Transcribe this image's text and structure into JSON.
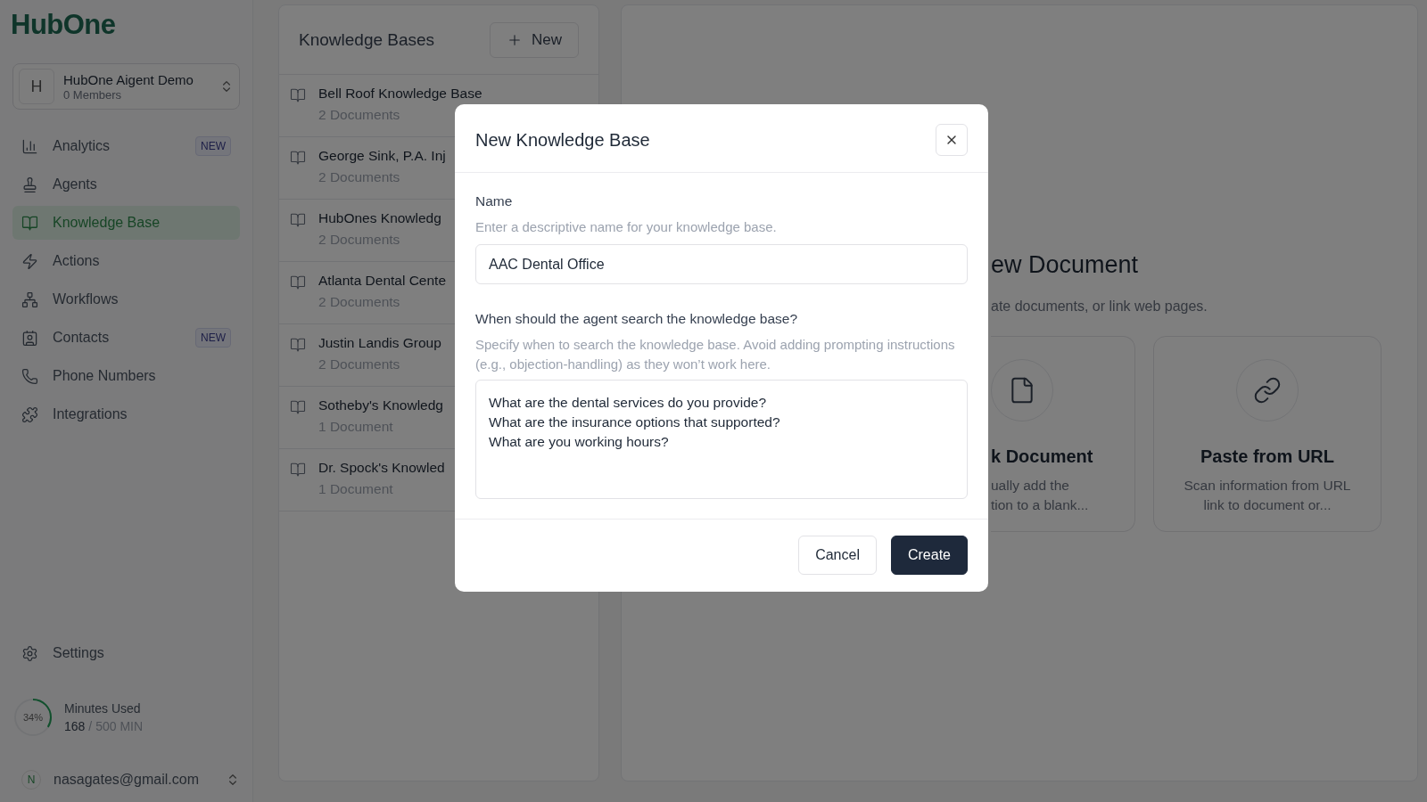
{
  "logo": {
    "text": "HubOne"
  },
  "workspace": {
    "initial": "H",
    "name": "HubOne Aigent Demo",
    "members": "0 Members"
  },
  "nav": [
    {
      "label": "Analytics",
      "badge": "NEW",
      "selected": false
    },
    {
      "label": "Agents",
      "selected": false
    },
    {
      "label": "Knowledge Base",
      "selected": true
    },
    {
      "label": "Actions",
      "selected": false
    },
    {
      "label": "Workflows",
      "selected": false
    },
    {
      "label": "Contacts",
      "badge": "NEW",
      "selected": false
    },
    {
      "label": "Phone Numbers",
      "selected": false
    },
    {
      "label": "Integrations",
      "selected": false
    }
  ],
  "settings": {
    "label": "Settings"
  },
  "usage": {
    "percent": "34%",
    "level": 0.34,
    "title": "Minutes Used",
    "used": "168",
    "total": "/ 500 MIN"
  },
  "account": {
    "initial": "N",
    "email": "nasagates@gmail.com"
  },
  "knowledge_bases": {
    "title": "Knowledge Bases",
    "new_button": "New",
    "items": [
      {
        "name": "Bell Roof Knowledge Base",
        "count": "2 Documents"
      },
      {
        "name": "George Sink, P.A. Inj",
        "count": "2 Documents"
      },
      {
        "name": "HubOnes Knowledg",
        "count": "2 Documents"
      },
      {
        "name": "Atlanta Dental Cente",
        "count": "2 Documents"
      },
      {
        "name": "Justin Landis Group",
        "count": "2 Documents"
      },
      {
        "name": "Sotheby's Knowledg",
        "count": "1 Document"
      },
      {
        "name": "Dr. Spock's Knowled",
        "count": "1 Document"
      }
    ]
  },
  "document_panel": {
    "title": "ew Document",
    "subtitle": "ate documents, or link web pages.",
    "cards": [
      {
        "kind": "blank",
        "title": "k Document",
        "description": "ually add the\ntion to a blank..."
      },
      {
        "kind": "url",
        "title": "Paste from URL",
        "description": "Scan information from URL\nlink to document or..."
      }
    ]
  },
  "dialog": {
    "title": "New Knowledge Base",
    "name_field": {
      "label": "Name",
      "hint": "Enter a descriptive name for your knowledge base.",
      "value": "AAC Dental Office"
    },
    "search_field": {
      "label": "When should the agent search the knowledge base?",
      "hint": "Specify when to search the knowledge base. Avoid adding prompting instructions (e.g., objection-handling) as they won’t work here.",
      "value": "What are the dental services do you provide?\nWhat are the insurance options that supported?\nWhat are you working hours?"
    },
    "cancel": "Cancel",
    "create": "Create"
  }
}
